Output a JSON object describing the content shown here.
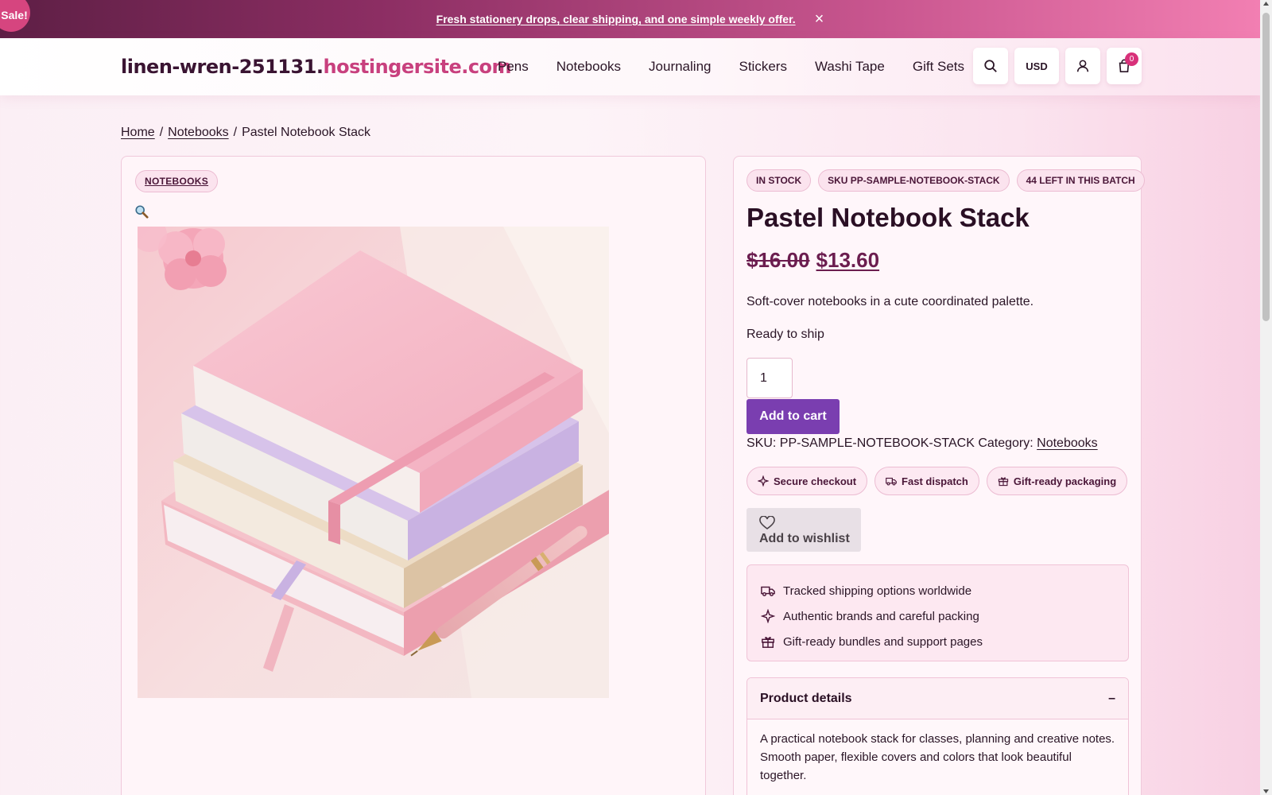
{
  "announcement": {
    "text": "Fresh stationery drops, clear shipping, and one simple weekly offer.",
    "close_label": "×"
  },
  "sale_badge": "Sale!",
  "header": {
    "logo_part1": "linen-wren-251131.",
    "logo_part2": "hostingersite.com",
    "nav": [
      "Pens",
      "Notebooks",
      "Journaling",
      "Stickers",
      "Washi Tape",
      "Gift Sets"
    ],
    "currency": "USD",
    "cart_count": "0",
    "icons": {
      "search": "search-icon",
      "account": "user-icon",
      "cart": "shopping-bag-icon"
    }
  },
  "breadcrumb": {
    "home": "Home",
    "category": "Notebooks",
    "current": "Pastel Notebook Stack",
    "sep": "/"
  },
  "gallery": {
    "category_pill": "NOTEBOOKS",
    "zoom_icon": "magnifier-icon"
  },
  "product": {
    "badges": [
      "IN STOCK",
      "SKU PP-SAMPLE-NOTEBOOK-STACK",
      "44 LEFT IN THIS BATCH"
    ],
    "title": "Pastel Notebook Stack",
    "price_old": "$16.00",
    "price_new": "$13.60",
    "short_description": "Soft-cover notebooks in a cute coordinated palette.",
    "stock_text": "Ready to ship",
    "quantity": "1",
    "add_to_cart": "Add to cart",
    "sku_label": "SKU:",
    "sku_value": "PP-SAMPLE-NOTEBOOK-STACK",
    "category_label": "Category:",
    "category_value": "Notebooks",
    "trust": [
      "Secure checkout",
      "Fast dispatch",
      "Gift-ready packaging"
    ],
    "wishlist": "Add to wishlist",
    "perks": [
      "Tracked shipping options worldwide",
      "Authentic brands and careful packing",
      "Gift-ready bundles and support pages"
    ],
    "details_title": "Product details",
    "details_toggle": "–",
    "details_text": "A practical notebook stack for classes, planning and creative notes. Smooth paper, flexible covers and colors that look beautiful together."
  },
  "colors": {
    "accent_purple": "#7a3eb0",
    "brand_pink": "#c8407e",
    "brand_dark": "#3a1432",
    "badge_pink": "#d8317a"
  }
}
